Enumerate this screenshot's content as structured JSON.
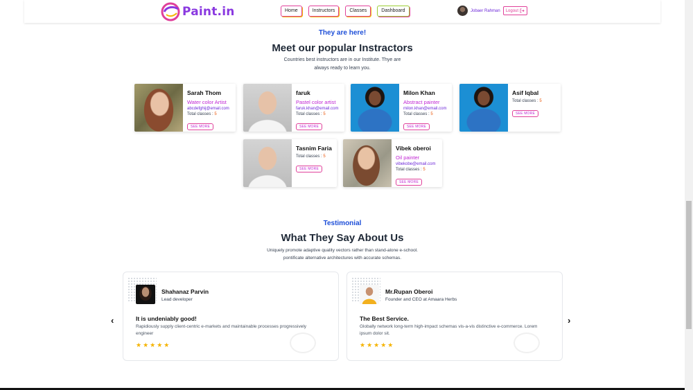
{
  "navbar": {
    "brand": "Paint.in",
    "links": [
      "Home",
      "Instructors",
      "Classes",
      "Dashboard"
    ],
    "user_name": "Jobaer Rahman",
    "logout_label": "Logout"
  },
  "instructors_section": {
    "kicker": "They are here!",
    "title": "Meet our popular Instractors",
    "subtitle_line1": "Countries best instructors are in our Institute. Thye are",
    "subtitle_line2": "always ready to learn you.",
    "cards": [
      {
        "name": "Sarah Thom",
        "role": "Water color Artist",
        "email": "abcdefghij@email.com",
        "classes_label": "Total classes :",
        "classes_count": "5",
        "button": "SEE MORE"
      },
      {
        "name": "faruk",
        "role": "Pastel color artist",
        "email": "faruk.khan@email.com",
        "classes_label": "Total classes :",
        "classes_count": "5",
        "button": "SEE MORE"
      },
      {
        "name": "Milon Khan",
        "role": "Abstract painter",
        "email": "milon.khan@email.com",
        "classes_label": "Total classes :",
        "classes_count": "5",
        "button": "SEE MORE"
      },
      {
        "name": "Asif Iqbal",
        "classes_label": "Total classes :",
        "classes_count": "5",
        "button": "SEE MORE"
      },
      {
        "name": "Tasnim Faria",
        "classes_label": "Total classes :",
        "classes_count": "5",
        "button": "SEE MORE"
      },
      {
        "name": "Vibek oberoi",
        "role": "Oil painter",
        "email": "vibekobe@email.com",
        "classes_label": "Total classes :",
        "classes_count": "5",
        "button": "SEE MORE"
      }
    ]
  },
  "testimonial_section": {
    "kicker": "Testimonial",
    "title": "What They Say About Us",
    "subtitle_line1": "Uniquely promote adaptive quality vectors rather than stand-alone e-school.",
    "subtitle_line2": "pontificate alternative architectures with accurate schemas.",
    "cards": [
      {
        "name": "Shahanaz Parvin",
        "role": "Lead developer",
        "heading": "It is undeniably good!",
        "body": "Rapidiously supply client-centric e-markets and maintainable processes progressively engineer",
        "stars": "★★★★★"
      },
      {
        "name": "Mr.Rupan Oberoi",
        "role": "Founder and CEO at Amaara Herbs",
        "heading": "The Best Service.",
        "body": "Globally network long-term high-impact schemas vis-a-vis distinctive e-commerce. Lorem ipsum dolor sit.",
        "stars": "★★★★★"
      }
    ],
    "prev_icon": "‹",
    "next_icon": "›"
  },
  "colors": {
    "accent_pink": "#e0409a",
    "accent_purple": "#8a39e0",
    "kicker_blue": "#1d4ed8",
    "star": "#f5b301"
  }
}
